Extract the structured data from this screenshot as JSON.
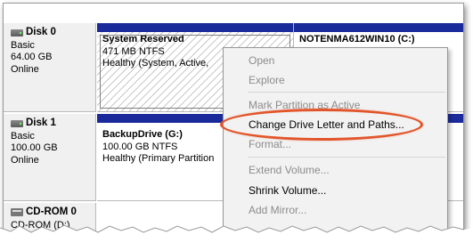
{
  "disks": [
    {
      "name": "Disk 0",
      "type": "Basic",
      "size": "64.00 GB",
      "status": "Online"
    },
    {
      "name": "Disk 1",
      "type": "Basic",
      "size": "100.00 GB",
      "status": "Online"
    },
    {
      "name": "CD-ROM 0",
      "sub": "CD-ROM (D:)"
    }
  ],
  "partitions": {
    "system_reserved": {
      "name": "System Reserved",
      "size_fs": "471 MB NTFS",
      "status": "Healthy (System, Active,"
    },
    "os_partition": {
      "name": "NOTENMA612WIN10 (C:)"
    },
    "backup": {
      "name": "BackupDrive  (G:)",
      "size_fs": "100.00 GB NTFS",
      "status": "Healthy (Primary Partition"
    }
  },
  "context_menu": {
    "open": "Open",
    "explore": "Explore",
    "mark_active": "Mark Partition as Active",
    "change_letter": "Change Drive Letter and Paths...",
    "format": "Format...",
    "extend": "Extend Volume...",
    "shrink": "Shrink Volume...",
    "add_mirror": "Add Mirror..."
  },
  "colors": {
    "partition_bar": "#1b2a9b",
    "highlight": "#e2552a",
    "menu_bg": "#f2f2f2",
    "disabled_text": "#8c8c8c"
  }
}
